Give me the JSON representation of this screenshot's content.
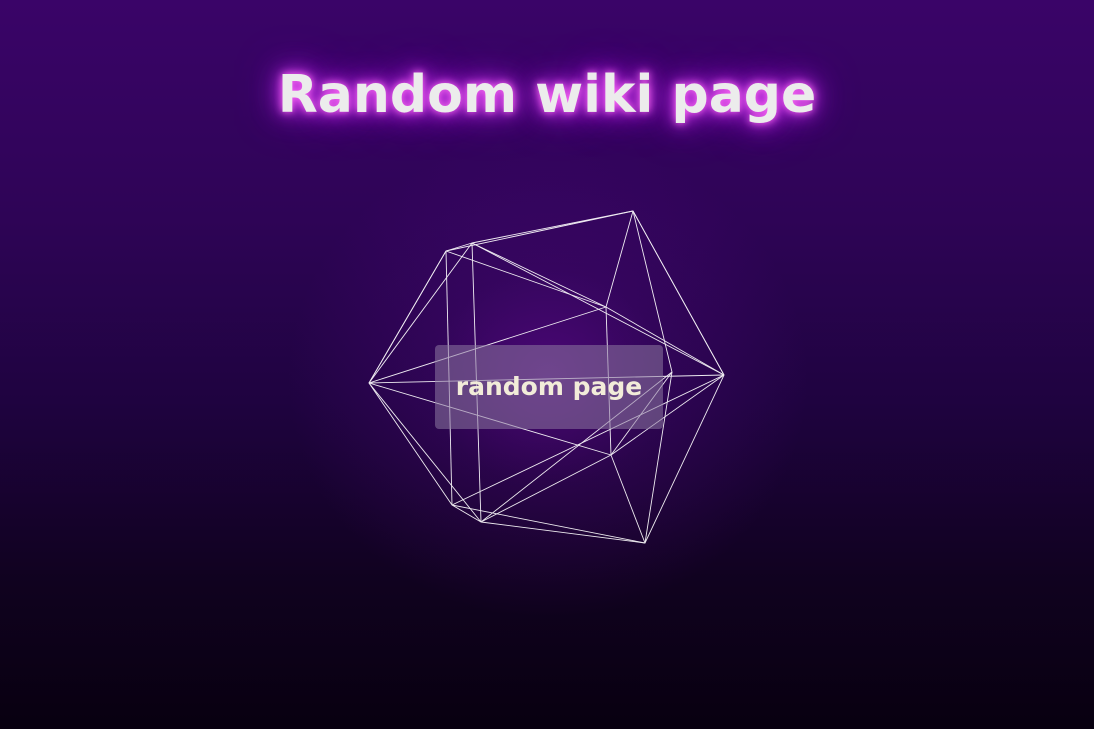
{
  "page": {
    "title": "Random wiki page"
  },
  "button": {
    "label": "random page"
  },
  "colors": {
    "background_top": "#3a0468",
    "background_bottom": "#080010",
    "title_text": "#ececec",
    "title_glow": "#d43af0",
    "wireframe": "#ffffff",
    "button_bg": "#8c78a0",
    "button_text": "#f2ecd9"
  },
  "decoration": {
    "shape": "icosahedron-wireframe"
  }
}
